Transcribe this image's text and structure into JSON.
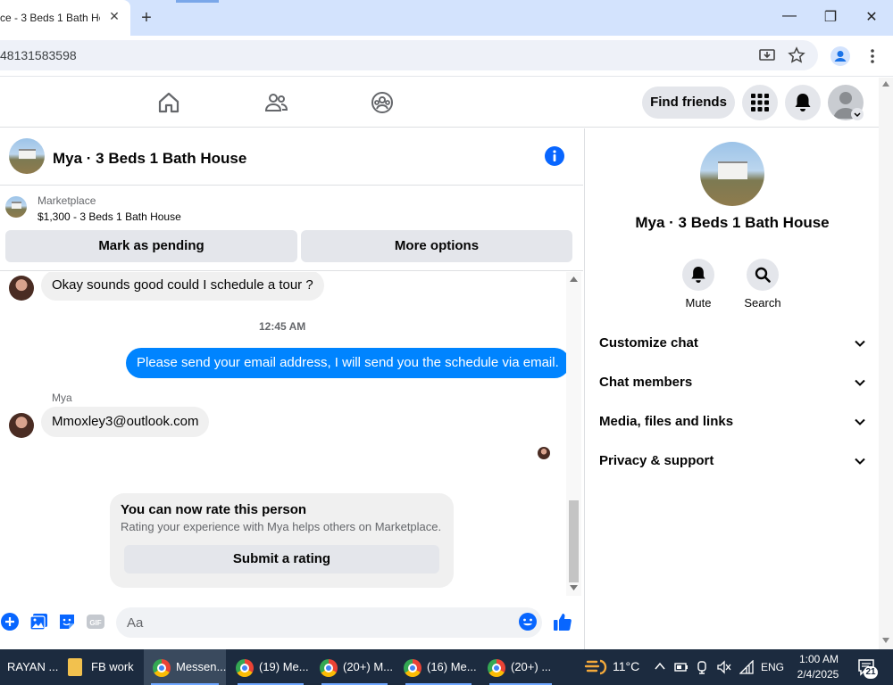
{
  "browser": {
    "tab_title": "ce - 3 Beds 1 Bath Ho",
    "tab_close": "✕",
    "new_tab": "+",
    "url": "48131583598",
    "window_controls": {
      "minimize": "—",
      "maximize": "❐",
      "close": "✕"
    }
  },
  "fb_header": {
    "find_friends": "Find friends",
    "nav_icons": [
      "home-icon",
      "friends-icon",
      "groups-icon"
    ],
    "right_icons": [
      "menu-grid-icon",
      "notifications-icon",
      "account-avatar"
    ]
  },
  "conversation": {
    "title": "Mya · 3 Beds 1 Bath House",
    "marketplace_label": "Marketplace",
    "listing": "$1,300 - 3 Beds 1 Bath House",
    "mark_pending": "Mark as pending",
    "more_options": "More options"
  },
  "messages": {
    "incoming_1": "Okay sounds good could I schedule a tour ?",
    "timestamp": "12:45 AM",
    "outgoing_1": "Please send your email address, I will send you the schedule via email.",
    "sender_name": "Mya",
    "incoming_2": "Mmoxley3@outlook.com"
  },
  "rating_card": {
    "title": "You can now rate this person",
    "subtitle": "Rating your experience with Mya helps others on Marketplace.",
    "button": "Submit a rating"
  },
  "composer": {
    "placeholder": "Aa",
    "icons": [
      "plus-icon",
      "photo-icon",
      "sticker-icon",
      "gif-icon",
      "emoji-icon",
      "like-icon"
    ]
  },
  "right_panel": {
    "name": "Mya · 3 Beds 1 Bath House",
    "mute": "Mute",
    "search": "Search",
    "sections": [
      "Customize chat",
      "Chat members",
      "Media, files and links",
      "Privacy & support"
    ]
  },
  "taskbar": {
    "apps": [
      "RAYAN ...",
      "FB work",
      "Messen...",
      "(19) Me...",
      "(20+) M...",
      "(16) Me...",
      "(20+) ..."
    ],
    "temperature": "11°C",
    "language": "ENG",
    "time": "1:00 AM",
    "date": "2/4/2025",
    "notification_count": "21"
  },
  "colors": {
    "messenger_blue": "#0084ff",
    "fb_gray": "#e4e6eb",
    "taskbar": "#1c2b3f"
  }
}
